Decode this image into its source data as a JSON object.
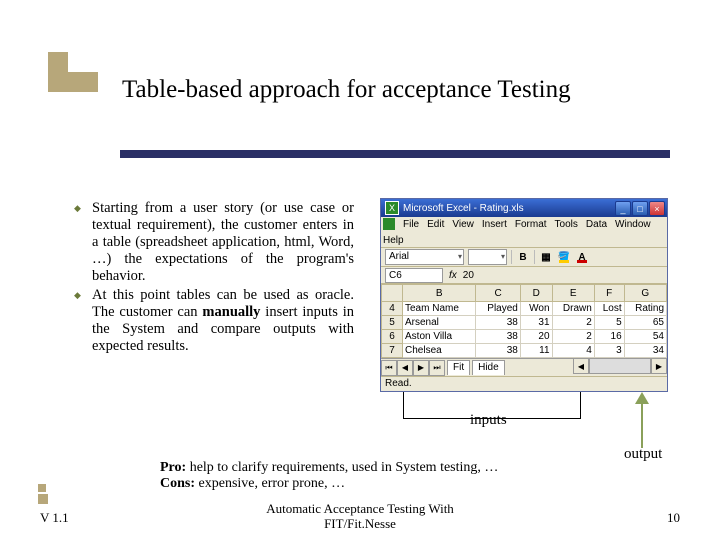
{
  "title": "Table-based approach for acceptance Testing",
  "bullets": [
    "Starting from a user story (or use case or textual requirement), the customer enters in a table (spreadsheet application, html, Word, …) the expectations of the program's behavior.",
    "At this point tables can be used as oracle. The customer can <b>manually</b> insert inputs in the System and compare outputs with expected results."
  ],
  "excel": {
    "title": "Microsoft Excel - Rating.xls",
    "menus": [
      "File",
      "Edit",
      "View",
      "Insert",
      "Format",
      "Tools",
      "Data",
      "Window",
      "Help"
    ],
    "font": "Arial",
    "active_cell": "C6",
    "formula_value": "20",
    "columns": [
      "",
      "B",
      "C",
      "D",
      "E",
      "F",
      "G"
    ],
    "headers_row": [
      "4",
      "Team Name",
      "Played",
      "Won",
      "Drawn",
      "Lost",
      "Rating"
    ],
    "data_rows": [
      [
        "5",
        "Arsenal",
        "38",
        "31",
        "2",
        "5",
        "65"
      ],
      [
        "6",
        "Aston Villa",
        "38",
        "20",
        "2",
        "16",
        "54"
      ],
      [
        "7",
        "Chelsea",
        "38",
        "11",
        "4",
        "3",
        "34"
      ]
    ],
    "sheet_tabs": [
      "Fit",
      "Hide"
    ],
    "status": "Read."
  },
  "callouts": {
    "inputs": "inputs",
    "output": "output"
  },
  "procons": {
    "pro_label": "Pro:",
    "pro_text": " help to clarify requirements, used in System testing, …",
    "cons_label": "Cons:",
    "cons_text": " expensive, error prone, …"
  },
  "footer": {
    "left": "V 1.1",
    "center1": "Automatic Acceptance Testing With",
    "center2": "FIT/Fit.Nesse",
    "right": "10"
  }
}
